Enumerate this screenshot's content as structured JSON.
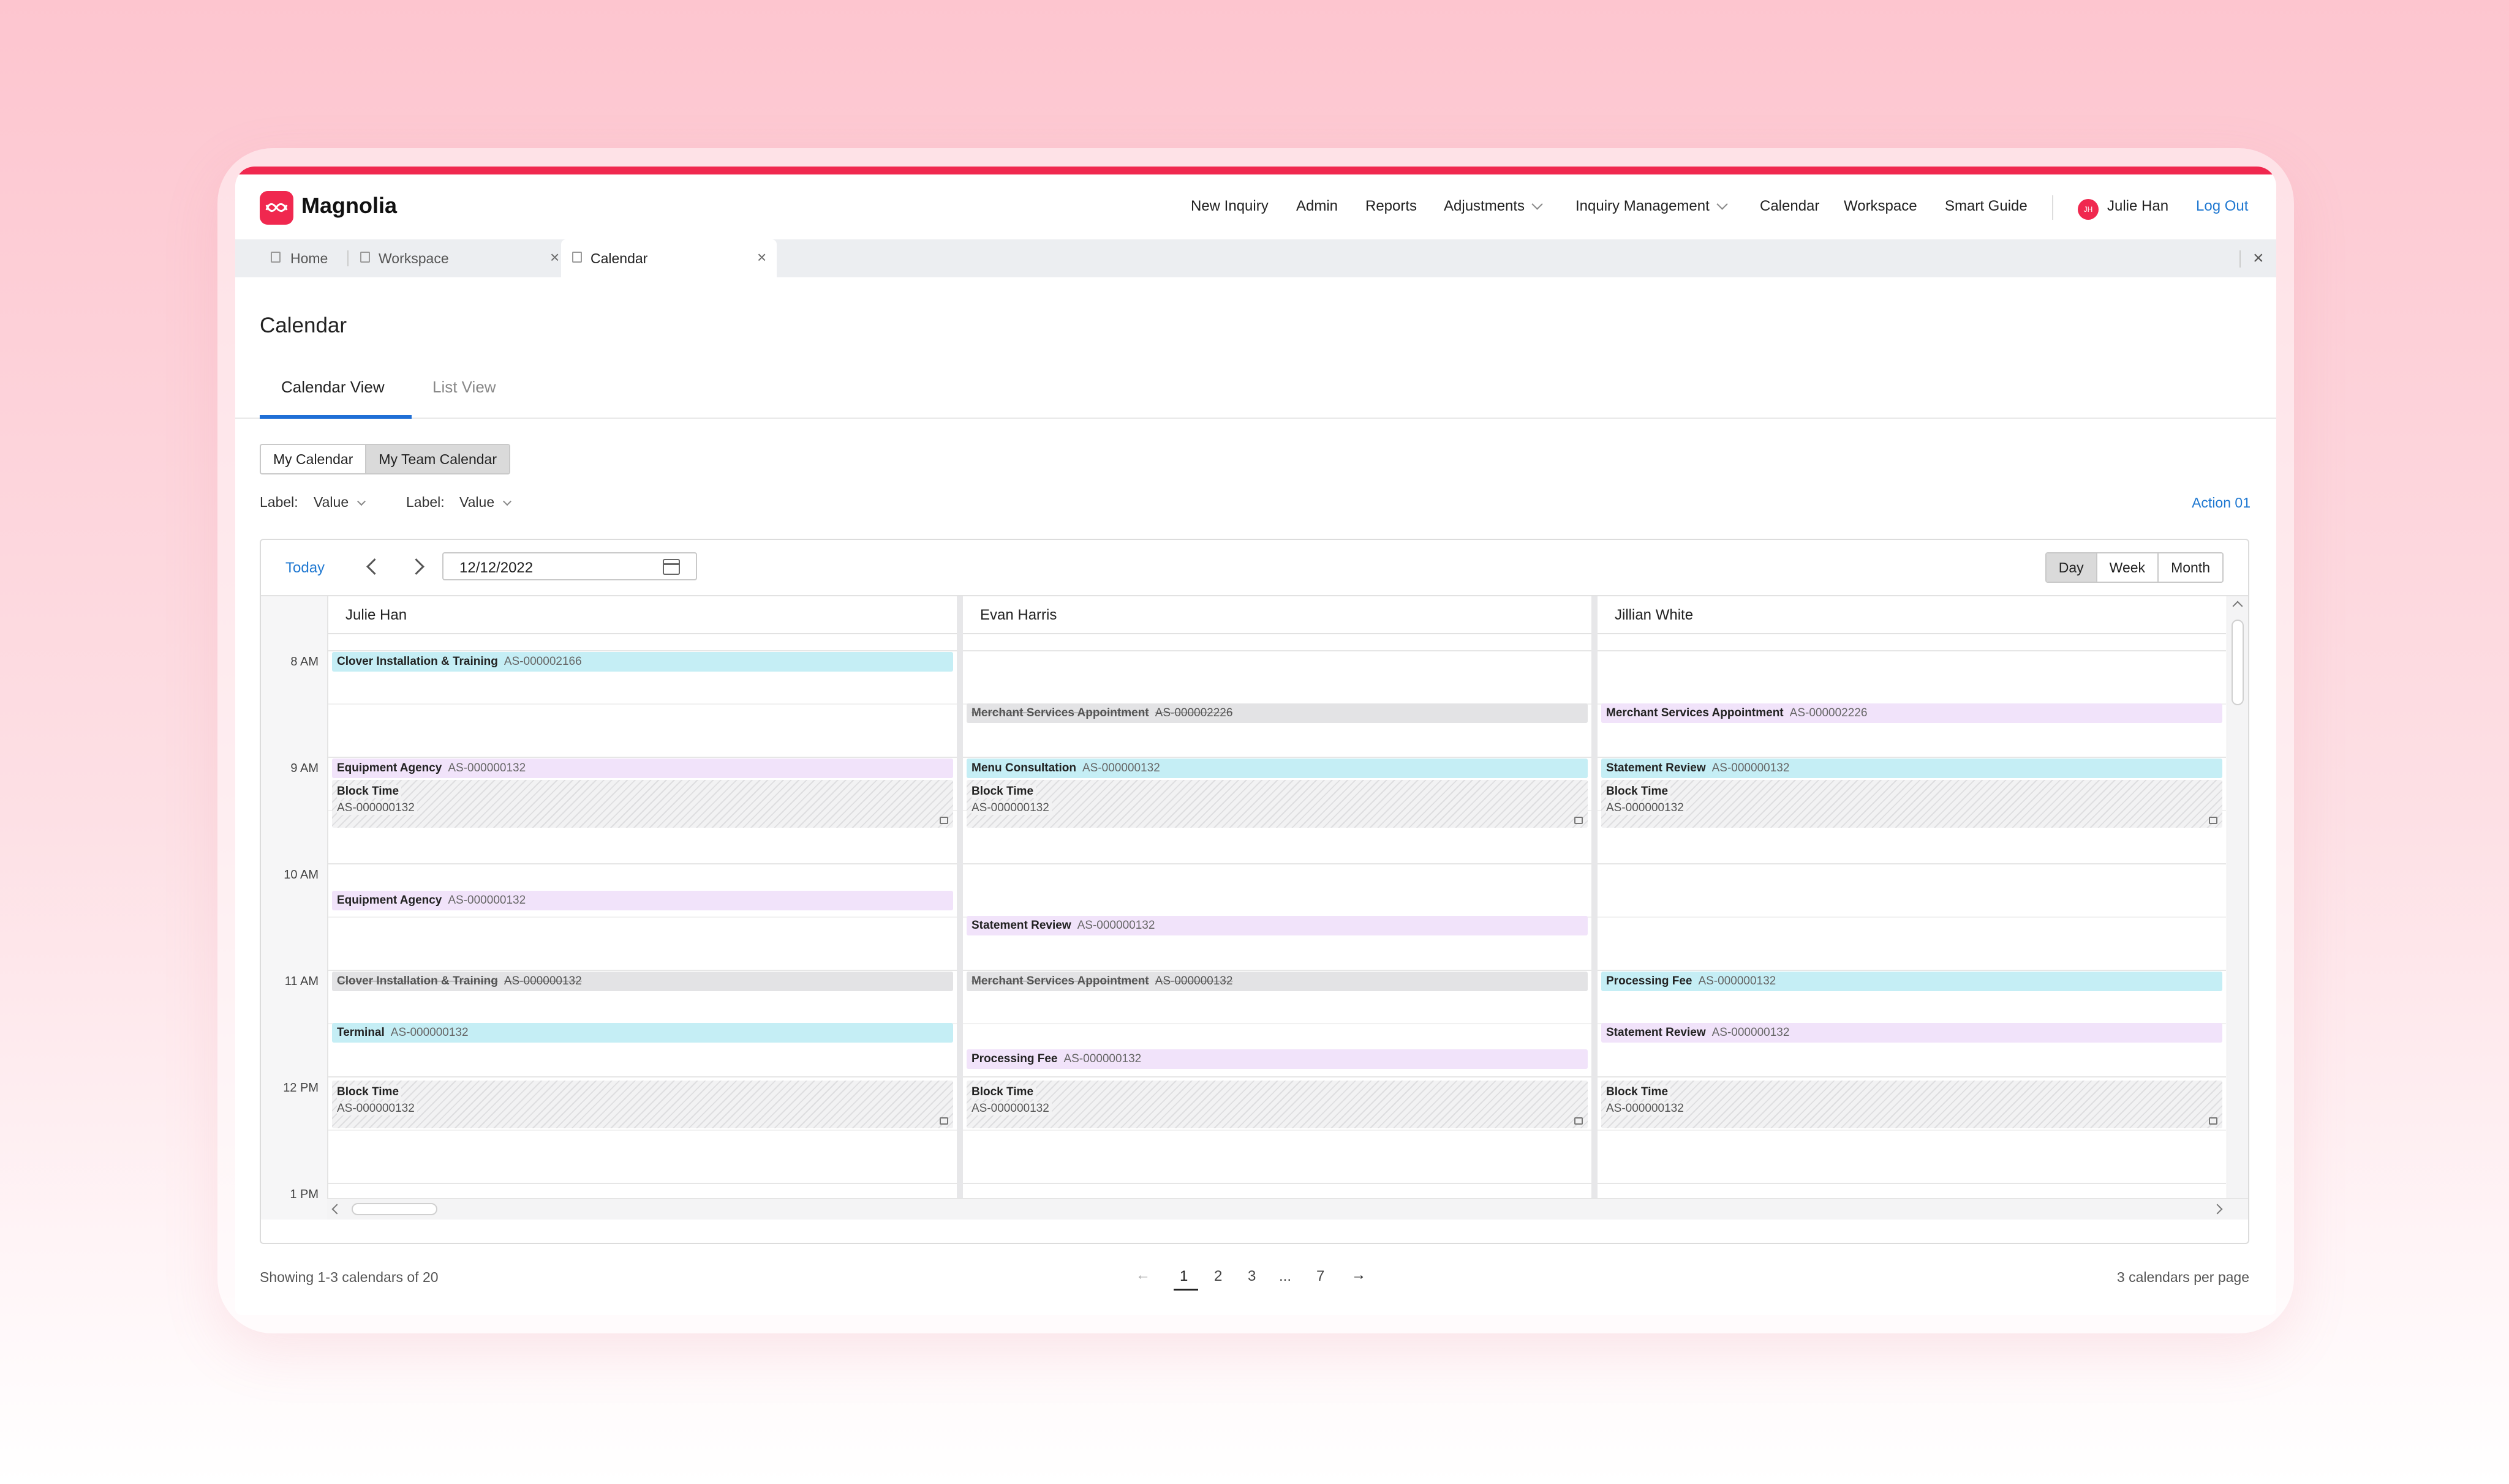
{
  "app": {
    "name": "Magnolia",
    "brand_color": "#f0284f"
  },
  "nav": {
    "items": [
      "New Inquiry",
      "Admin",
      "Reports",
      "Adjustments",
      "Inquiry Management",
      "Calendar",
      "Workspace",
      "Smart Guide"
    ],
    "user_initials": "JH",
    "user_name": "Julie Han",
    "logout": "Log Out"
  },
  "tabs": [
    {
      "label": "Home",
      "icon": "home-icon"
    },
    {
      "label": "Workspace",
      "icon": "workspace-icon"
    },
    {
      "label": "Calendar",
      "icon": "document-icon",
      "active": true
    }
  ],
  "page": {
    "title": "Calendar"
  },
  "view_tabs": [
    {
      "label": "Calendar View",
      "active": true
    },
    {
      "label": "List View"
    }
  ],
  "calendar_toggle": [
    {
      "label": "My Calendar"
    },
    {
      "label": "My Team Calendar",
      "active": true
    }
  ],
  "filters": [
    {
      "label": "Label:",
      "value": "Value"
    },
    {
      "label": "Label:",
      "value": "Value"
    }
  ],
  "action": "Action 01",
  "toolbar": {
    "today": "Today",
    "date": "12/12/2022",
    "views": [
      "Day",
      "Week",
      "Month"
    ],
    "active_view": "Day"
  },
  "times": [
    "8 AM",
    "9 AM",
    "10 AM",
    "11 AM",
    "12 PM",
    "1 PM"
  ],
  "columns": [
    {
      "name": "Julie Han",
      "events": [
        {
          "title": "Clover Installation & Training",
          "id": "AS-000002166",
          "color": "cyan"
        },
        {
          "title": "Equipment Agency",
          "id": "AS-000000132",
          "color": "purple"
        },
        {
          "title": "Block Time",
          "id": "AS-000000132",
          "type": "block"
        },
        {
          "title": "Equipment Agency",
          "id": "AS-000000132",
          "color": "purple"
        },
        {
          "title": "Clover Installation & Training",
          "id": "AS-000000132",
          "color": "gray",
          "cancelled": true
        },
        {
          "title": "Terminal",
          "id": "AS-000000132",
          "color": "cyan"
        },
        {
          "title": "Block Time",
          "id": "AS-000000132",
          "type": "block"
        }
      ]
    },
    {
      "name": "Evan Harris",
      "events": [
        {
          "title": "Merchant Services Appointment",
          "id": "AS-000002226",
          "color": "gray",
          "cancelled": true
        },
        {
          "title": "Menu Consultation",
          "id": "AS-000000132",
          "color": "cyan"
        },
        {
          "title": "Block Time",
          "id": "AS-000000132",
          "type": "block"
        },
        {
          "title": "Statement Review",
          "id": "AS-000000132",
          "color": "purple"
        },
        {
          "title": "Merchant Services Appointment",
          "id": "AS-000000132",
          "color": "gray",
          "cancelled": true
        },
        {
          "title": "Processing Fee",
          "id": "AS-000000132",
          "color": "purple"
        },
        {
          "title": "Block Time",
          "id": "AS-000000132",
          "type": "block"
        }
      ]
    },
    {
      "name": "Jillian White",
      "events": [
        {
          "title": "Merchant Services Appointment",
          "id": "AS-000002226",
          "color": "purple"
        },
        {
          "title": "Statement Review",
          "id": "AS-000000132",
          "color": "cyan"
        },
        {
          "title": "Block Time",
          "id": "AS-000000132",
          "type": "block"
        },
        {
          "title": "Processing Fee",
          "id": "AS-000000132",
          "color": "cyan"
        },
        {
          "title": "Statement Review",
          "id": "AS-000000132",
          "color": "purple"
        },
        {
          "title": "Block Time",
          "id": "AS-000000132",
          "type": "block"
        }
      ]
    }
  ],
  "footer": {
    "showing": "Showing 1-3 calendars of 20",
    "pages": [
      "1",
      "2",
      "3",
      "...",
      "7"
    ],
    "current_page": "1",
    "per_page": "3 calendars per page"
  }
}
